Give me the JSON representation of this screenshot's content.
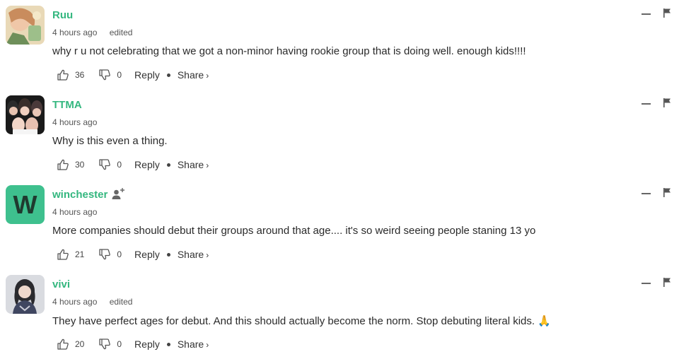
{
  "comments": [
    {
      "author": "Ruu",
      "time": "4 hours ago",
      "edited": "edited",
      "text": "why r u not celebrating that we got a non-minor having rookie group that is doing well. enough kids!!!!",
      "likes": "36",
      "dislikes": "0",
      "reply_label": "Reply",
      "share_label": "Share"
    },
    {
      "author": "TTMA",
      "time": "4 hours ago",
      "edited": "",
      "text": "Why is this even a thing.",
      "likes": "30",
      "dislikes": "0",
      "reply_label": "Reply",
      "share_label": "Share"
    },
    {
      "author": "winchester",
      "avatar_letter": "W",
      "time": "4 hours ago",
      "edited": "",
      "text": "More companies should debut their groups around that age.... it's so weird seeing people staning 13 yo",
      "likes": "21",
      "dislikes": "0",
      "reply_label": "Reply",
      "share_label": "Share"
    },
    {
      "author": "vivi",
      "time": "4 hours ago",
      "edited": "edited",
      "text": "They have perfect ages for debut. And this should actually become the norm. Stop debuting literal kids. 🙏",
      "likes": "20",
      "dislikes": "0",
      "reply_label": "Reply",
      "share_label": "Share"
    }
  ],
  "colors": {
    "author": "#34b77f",
    "avatar_w": "#3ec08e"
  },
  "icons": [
    "thumbs-up-icon",
    "thumbs-down-icon",
    "collapse-icon",
    "flag-icon",
    "follow-user-icon",
    "chevron-right-icon"
  ]
}
